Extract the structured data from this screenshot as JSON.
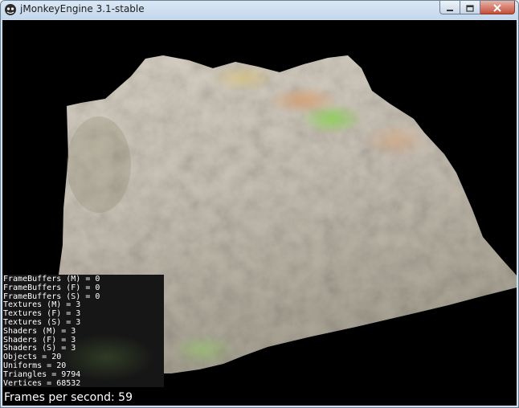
{
  "window": {
    "title": "jMonkeyEngine 3.1-stable",
    "app_icon": "jmonkey-logo-icon",
    "controls": [
      {
        "name": "minimize",
        "icon": "minimize-icon"
      },
      {
        "name": "maximize",
        "icon": "maximize-icon"
      },
      {
        "name": "close",
        "icon": "close-icon"
      }
    ]
  },
  "viewport": {
    "scene": "textured terrain heightmap",
    "background_color": "#000000",
    "stats": [
      "FrameBuffers (M) = 0",
      "FrameBuffers (F) = 0",
      "FrameBuffers (S) = 0",
      "Textures (M) = 3",
      "Textures (F) = 3",
      "Textures (S) = 3",
      "Shaders (M) = 3",
      "Shaders (F) = 3",
      "Shaders (S) = 3",
      "Objects = 20",
      "Uniforms = 20",
      "Triangles = 9794",
      "Vertices = 68532"
    ],
    "fps_text": "Frames per second: 59"
  }
}
